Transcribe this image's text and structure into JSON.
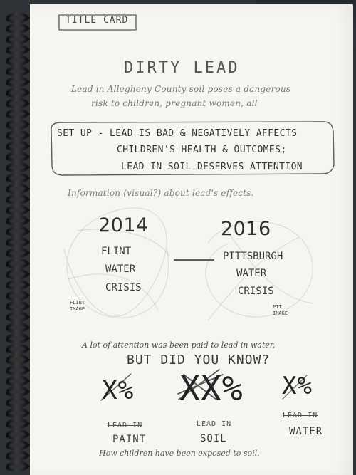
{
  "page": {
    "title_card": "TITLE CARD",
    "title": "DIRTY LEAD",
    "subtitle_lines": [
      "Lead in Allegheny County soil poses a dangerous",
      "risk to children, pregnant women, all"
    ],
    "setup_lines": [
      "SET UP - LEAD IS BAD & NEGATIVELY AFFECTS",
      "CHILDREN'S HEALTH & OUTCOMES;",
      "LEAD IN SOIL DESERVES ATTENTION"
    ],
    "info_line": "Information (visual?) about lead's effects.",
    "events": [
      {
        "year": "2014",
        "lines": [
          "FLINT",
          "WATER",
          "CRISIS"
        ],
        "image_note": [
          "FLINT",
          "IMAGE"
        ]
      },
      {
        "year": "2016",
        "lines": [
          "PITTSBURGH",
          "WATER",
          "CRISIS"
        ],
        "image_note": [
          "PIT",
          "IMAGE"
        ]
      }
    ],
    "attention_line": "A lot of attention was been paid to lead in water,",
    "know_line": "BUT DID YOU KNOW?",
    "percent_marks": [
      "X%",
      "XX%",
      "X%"
    ],
    "labels": [
      {
        "strike": "LEAD IN",
        "word": "PAINT"
      },
      {
        "strike": "LEAD IN",
        "word": "SOIL"
      },
      {
        "strike": "LEAD IN",
        "word": "WATER"
      }
    ],
    "bottom_line": "How children have been exposed to soil."
  },
  "colors": {
    "paper": "#f6f5f1",
    "pencil": "#4d4d4d",
    "spiral": "#171717",
    "desk": "#2f3337"
  }
}
